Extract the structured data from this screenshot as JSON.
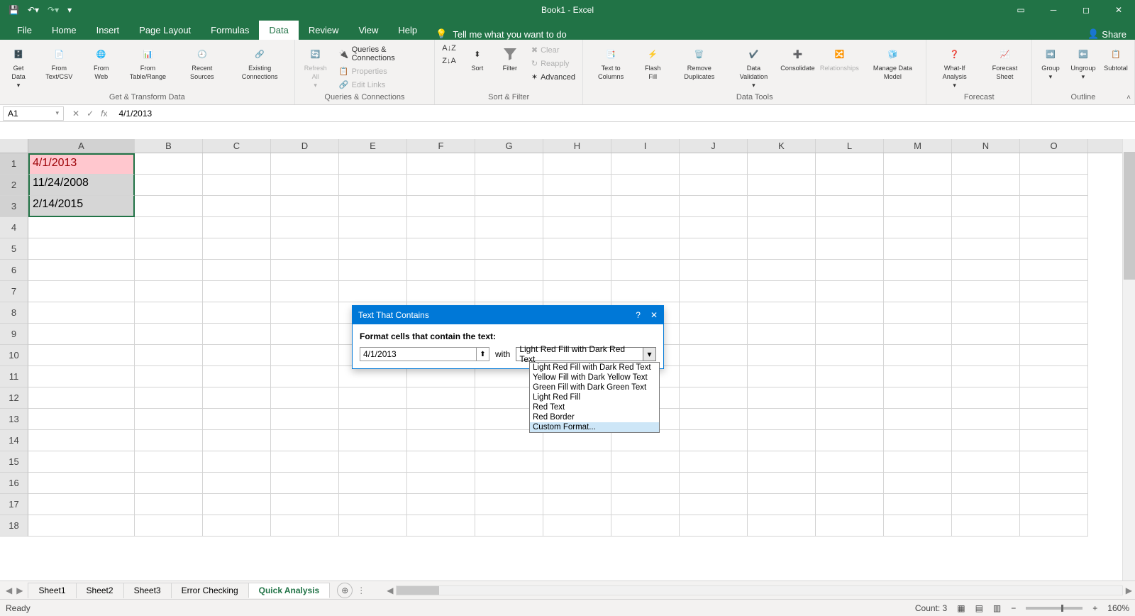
{
  "app": {
    "title": "Book1 - Excel",
    "share": "Share"
  },
  "tabs": [
    "File",
    "Home",
    "Insert",
    "Page Layout",
    "Formulas",
    "Data",
    "Review",
    "View",
    "Help"
  ],
  "active_tab": "Data",
  "tellme_placeholder": "Tell me what you want to do",
  "ribbon": {
    "groups": {
      "get_transform": {
        "label": "Get & Transform Data",
        "items": [
          "Get Data",
          "From Text/CSV",
          "From Web",
          "From Table/Range",
          "Recent Sources",
          "Existing Connections"
        ]
      },
      "queries": {
        "label": "Queries & Connections",
        "refresh": "Refresh All",
        "sub": [
          "Queries & Connections",
          "Properties",
          "Edit Links"
        ]
      },
      "sort_filter": {
        "label": "Sort & Filter",
        "sort": "Sort",
        "filter": "Filter",
        "clear": "Clear",
        "reapply": "Reapply",
        "advanced": "Advanced"
      },
      "data_tools": {
        "label": "Data Tools",
        "items": [
          "Text to Columns",
          "Flash Fill",
          "Remove Duplicates",
          "Data Validation",
          "Consolidate",
          "Relationships",
          "Manage Data Model"
        ]
      },
      "forecast": {
        "label": "Forecast",
        "items": [
          "What-If Analysis",
          "Forecast Sheet"
        ]
      },
      "outline": {
        "label": "Outline",
        "items": [
          "Group",
          "Ungroup",
          "Subtotal"
        ]
      }
    }
  },
  "formula_bar": {
    "name_box": "A1",
    "formula": "4/1/2013"
  },
  "columns": [
    "A",
    "B",
    "C",
    "D",
    "E",
    "F",
    "G",
    "H",
    "I",
    "J",
    "K",
    "L",
    "M",
    "N",
    "O"
  ],
  "row_count": 18,
  "cells": {
    "A1": "4/1/2013",
    "A2": "11/24/2008",
    "A3": "2/14/2015"
  },
  "selected_range": "A1:A3",
  "sheets": [
    "Sheet1",
    "Sheet2",
    "Sheet3",
    "Error Checking",
    "Quick Analysis"
  ],
  "active_sheet": "Quick Analysis",
  "statusbar": {
    "left": "Ready",
    "count": "Count: 3",
    "zoom": "160%"
  },
  "dialog": {
    "title": "Text That Contains",
    "prompt": "Format cells that contain the text:",
    "value": "4/1/2013",
    "with_label": "with",
    "combo_value": "Light Red Fill with Dark Red Text",
    "options": [
      "Light Red Fill with Dark Red Text",
      "Yellow Fill with Dark Yellow Text",
      "Green Fill with Dark Green Text",
      "Light Red Fill",
      "Red Text",
      "Red Border",
      "Custom Format..."
    ],
    "highlighted_option": "Custom Format..."
  }
}
